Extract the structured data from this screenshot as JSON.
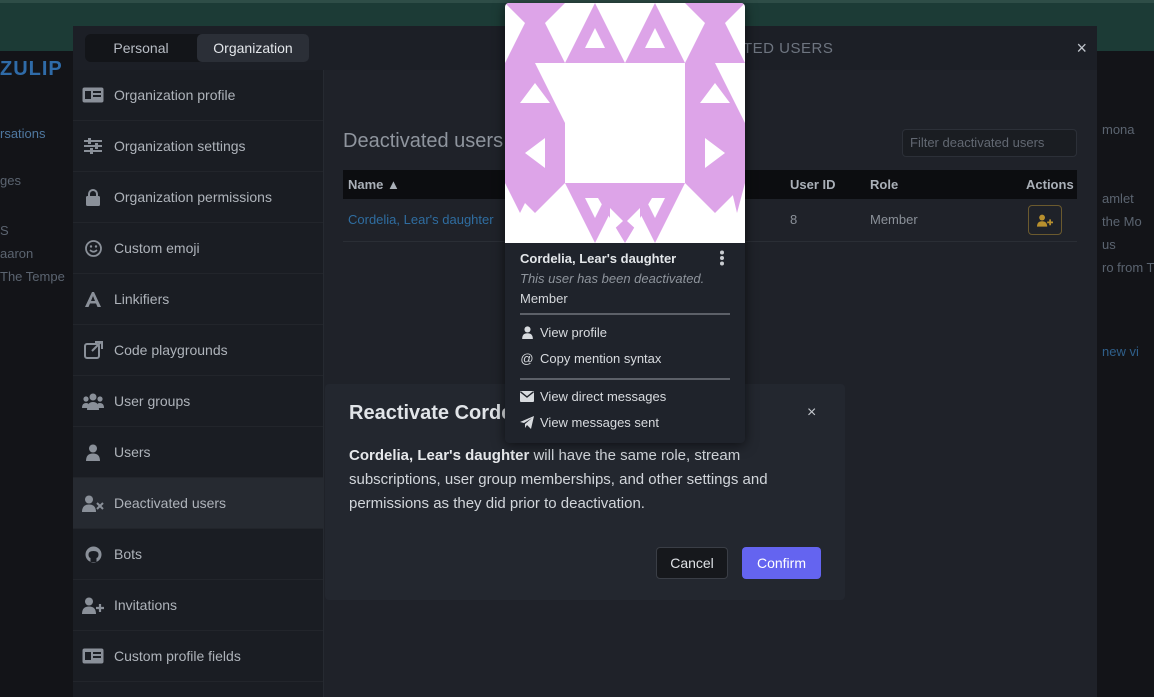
{
  "background": {
    "logo": "ZULIP",
    "left_fragments": [
      "rsations",
      "ges",
      "S",
      "aaron",
      "The Tempe"
    ],
    "right_fragments": [
      "mona",
      "amlet",
      "the Mo",
      "us",
      "ro from T",
      "new vi"
    ]
  },
  "settings": {
    "tabs": [
      {
        "label": "Personal"
      },
      {
        "label": "Organization"
      }
    ],
    "header_title": "TED USERS",
    "close_glyph": "×",
    "sidebar": [
      {
        "label": "Organization profile",
        "icon": "id-card-icon"
      },
      {
        "label": "Organization settings",
        "icon": "sliders-icon"
      },
      {
        "label": "Organization permissions",
        "icon": "lock-icon"
      },
      {
        "label": "Custom emoji",
        "icon": "smiley-icon"
      },
      {
        "label": "Linkifiers",
        "icon": "font-a-icon"
      },
      {
        "label": "Code playgrounds",
        "icon": "external-link-icon"
      },
      {
        "label": "User groups",
        "icon": "users-group-icon"
      },
      {
        "label": "Users",
        "icon": "user-icon"
      },
      {
        "label": "Deactivated users",
        "icon": "user-x-icon"
      },
      {
        "label": "Bots",
        "icon": "github-icon"
      },
      {
        "label": "Invitations",
        "icon": "user-plus-icon"
      },
      {
        "label": "Custom profile fields",
        "icon": "id-card-icon"
      }
    ]
  },
  "main": {
    "title": "Deactivated users",
    "filter_placeholder": "Filter deactivated users",
    "columns": {
      "name": "Name ▲",
      "user_id": "User ID",
      "role": "Role",
      "actions": "Actions"
    },
    "rows": [
      {
        "name": "Cordelia, Lear's daughter",
        "user_id": "8",
        "role": "Member"
      }
    ]
  },
  "modal": {
    "title": "Reactivate Cordelia, Lear's daughter",
    "close_glyph": "×",
    "body_name": "Cordelia, Lear's daughter",
    "body_text": " will have the same role, stream subscriptions, user group memberships, and other settings and permissions as they did prior to deactivation.",
    "cancel_label": "Cancel",
    "confirm_label": "Confirm"
  },
  "popover": {
    "name": "Cordelia, Lear's daughter",
    "status": "This user has been deactivated.",
    "role": "Member",
    "items_group1": [
      {
        "label": "View profile",
        "icon": "user-icon"
      },
      {
        "label": "Copy mention syntax",
        "icon": "at-icon"
      }
    ],
    "items_group2": [
      {
        "label": "View direct messages",
        "icon": "envelope-icon"
      },
      {
        "label": "View messages sent",
        "icon": "paper-plane-icon"
      }
    ],
    "avatar_color": "#dda4e8"
  }
}
